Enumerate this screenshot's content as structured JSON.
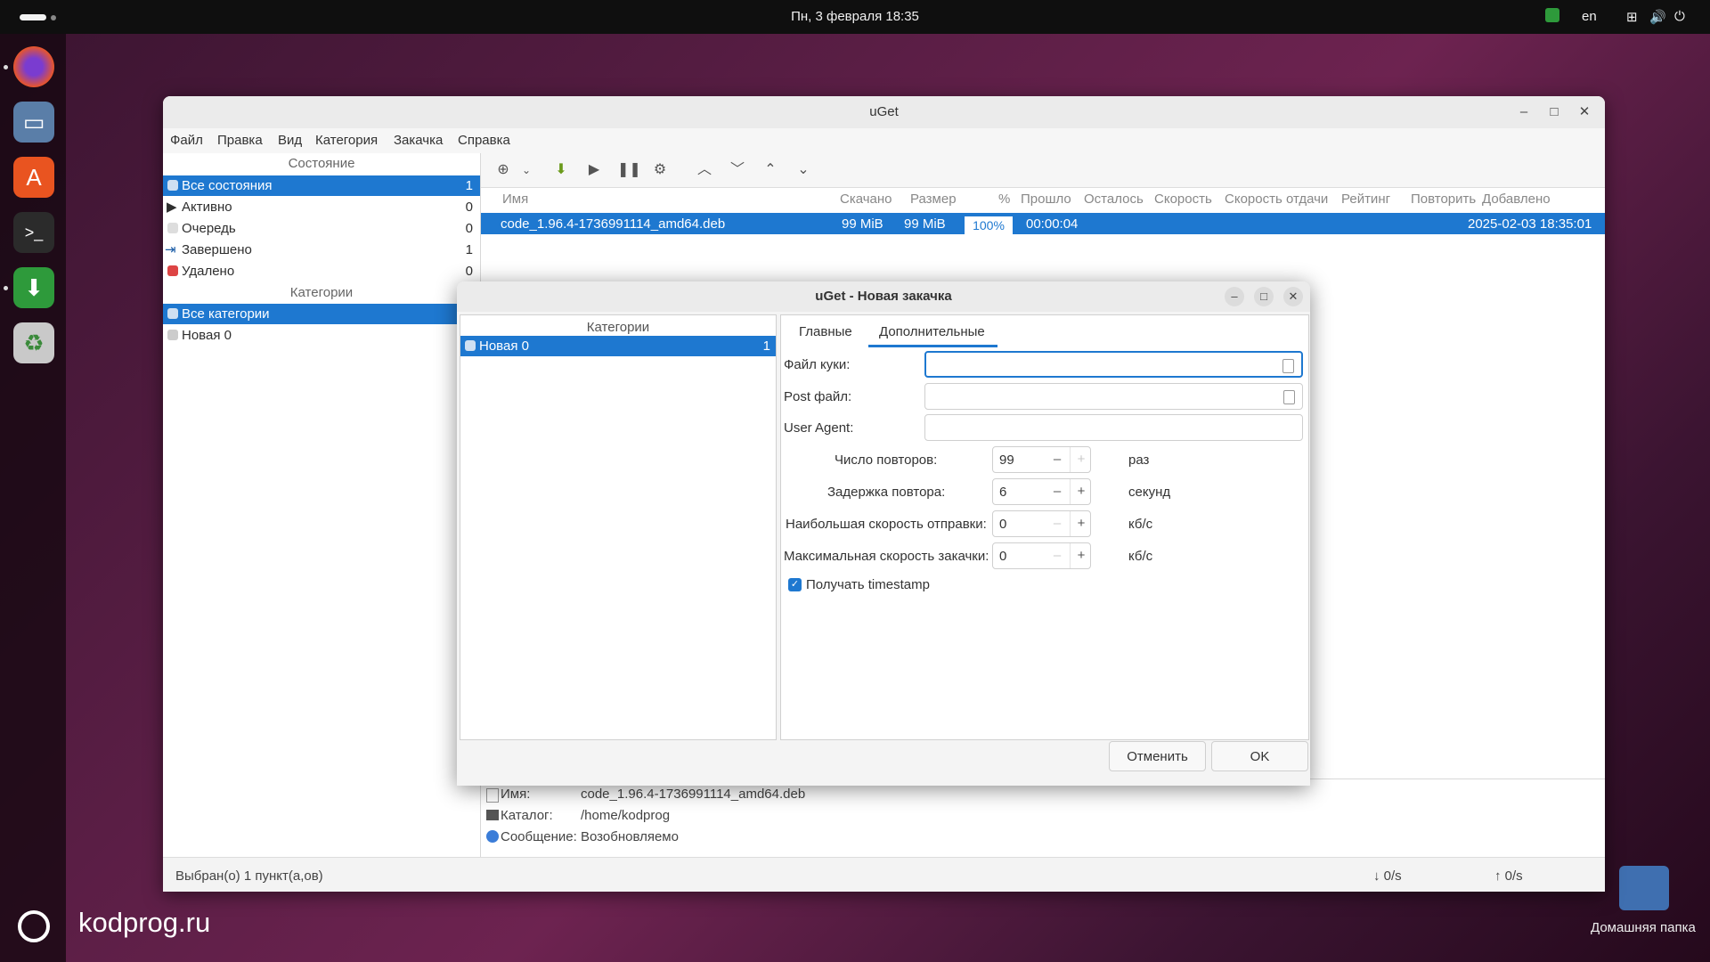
{
  "topbar": {
    "clock": "Пн, 3 февраля  18:35",
    "lang": "en"
  },
  "desktop": {
    "brand": "kodprog.ru",
    "home_label": "Домашняя папка"
  },
  "window": {
    "title": "uGet"
  },
  "menu": [
    "Файл",
    "Правка",
    "Вид",
    "Категория",
    "Закачка",
    "Справка"
  ],
  "sidebar": {
    "state_header": "Состояние",
    "states": [
      {
        "label": "Все состояния",
        "count": "1"
      },
      {
        "label": "Активно",
        "count": "0"
      },
      {
        "label": "Очередь",
        "count": "0"
      },
      {
        "label": "Завершено",
        "count": "1"
      },
      {
        "label": "Удалено",
        "count": "0"
      }
    ],
    "cat_header": "Категории",
    "categories": [
      {
        "label": "Все категории"
      },
      {
        "label": "Новая 0"
      }
    ]
  },
  "list": {
    "columns": [
      "Имя",
      "Скачано",
      "Размер",
      "%",
      "Прошло",
      "Осталось",
      "Скорость",
      "Скорость отдачи",
      "Рейтинг",
      "Повторить",
      "Добавлено"
    ],
    "row": {
      "name": "code_1.96.4-1736991114_amd64.deb",
      "downloaded": "99 MiB",
      "size": "99 MiB",
      "percent": "100%",
      "elapsed": "00:00:04",
      "added": "2025-02-03 18:35:01"
    }
  },
  "details": {
    "name_label": "Имя:",
    "name_value": "code_1.96.4-1736991114_amd64.deb",
    "dir_label": "Каталог:",
    "dir_value": "/home/kodprog",
    "msg_label": "Сообщение:",
    "msg_value": "Возобновляемо"
  },
  "status": {
    "selected": "Выбран(о) 1 пункт(а,ов)",
    "down": "↓ 0/s",
    "up": "↑ 0/s"
  },
  "dialog": {
    "title": "uGet - Новая закачка",
    "cat_header": "Категории",
    "cat_item": "Новая 0",
    "cat_count": "1",
    "tabs": [
      "Главные",
      "Дополнительные"
    ],
    "cookie_label": "Файл куки:",
    "post_label": "Post файл:",
    "ua_label": "User Agent:",
    "retries_label": "Число повторов:",
    "retries_value": "99",
    "retries_unit": "раз",
    "delay_label": "Задержка повтора:",
    "delay_value": "6",
    "delay_unit": "секунд",
    "upload_label": "Наибольшая скорость отправки:",
    "upload_value": "0",
    "upload_unit": "кб/с",
    "download_label": "Максимальная скорость закачки:",
    "download_value": "0",
    "download_unit": "кб/с",
    "timestamp_label": "Получать timestamp",
    "cancel": "Отменить",
    "ok": "OK"
  }
}
